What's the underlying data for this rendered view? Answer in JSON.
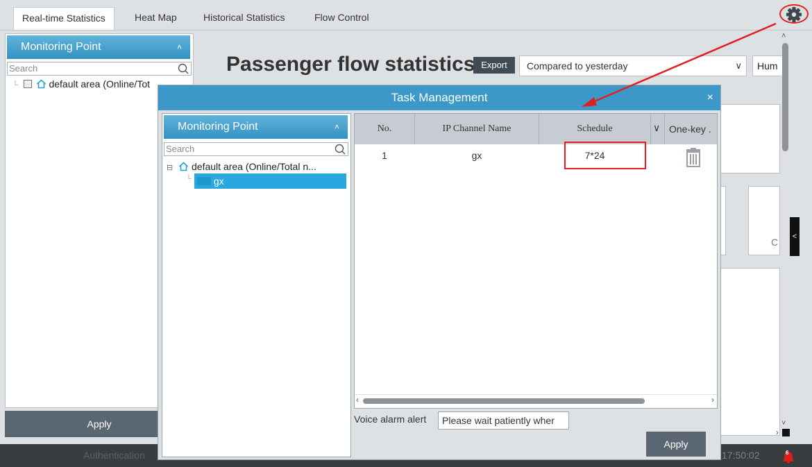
{
  "tabs": [
    "Real-time Statistics",
    "Heat Map",
    "Historical Statistics",
    "Flow Control"
  ],
  "icons": {
    "settings": "gear-icon"
  },
  "background": {
    "monitoring_point_title": "Monitoring Point",
    "search_placeholder": "Search",
    "tree_root": "default area (Online/Tot",
    "apply": "Apply",
    "main_title": "Passenger flow statistics",
    "export": "Export",
    "compare_value": "Compared to yesterday",
    "hum_value": "Hum",
    "card_text": "C"
  },
  "status_bar": {
    "text": "Authentication",
    "time": "17:50:02",
    "alarm_count": "6"
  },
  "dialog": {
    "title": "Task Management",
    "close": "×",
    "monitoring_point_title": "Monitoring Point",
    "search_placeholder": "Search",
    "tree_root": "default area (Online/Total n...",
    "tree_child": "gx",
    "columns": [
      "No.",
      "IP Channel Name",
      "Schedule",
      "One-key ."
    ],
    "rows": [
      {
        "no": "1",
        "channel": "gx",
        "schedule": "7*24"
      }
    ],
    "voice_label": "Voice alarm alert",
    "voice_value": "Please wait patiently wher",
    "apply": "Apply"
  },
  "colors": {
    "accent": "#3c98c8",
    "highlight": "#e02020",
    "selected": "#29a8e0"
  }
}
